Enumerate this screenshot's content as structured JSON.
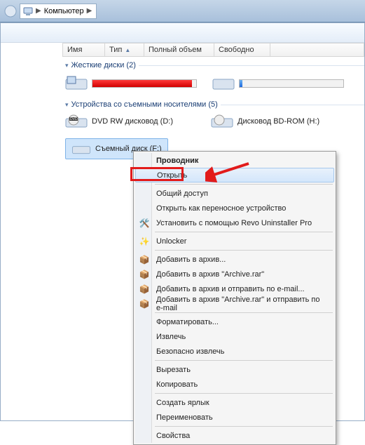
{
  "breadcrumb": {
    "location": "Компьютер"
  },
  "columns": {
    "name": "Имя",
    "type": "Тип",
    "total": "Полный объем",
    "free": "Свободно"
  },
  "groups": {
    "hdd": {
      "label": "Жесткие диски (2)"
    },
    "removable": {
      "label": "Устройства со съемными носителями (5)"
    }
  },
  "devices": {
    "dvd": "DVD RW дисковод (D:)",
    "bd": "Дисковод BD-ROM (H:)",
    "removable_selected": "Съемный диск (F:)"
  },
  "ctx": {
    "explorer": "Проводник",
    "open": "Открыть",
    "share": "Общий доступ",
    "portable": "Открыть как переносное устройство",
    "revo": "Установить с помощью Revo Uninstaller Pro",
    "unlocker": "Unlocker",
    "archive_add": "Добавить в архив...",
    "archive_named": "Добавить в архив \"Archive.rar\"",
    "archive_email": "Добавить в архив и отправить по e-mail...",
    "archive_named_email": "Добавить в архив \"Archive.rar\" и отправить по e-mail",
    "format": "Форматировать...",
    "eject": "Извлечь",
    "safe_eject": "Безопасно извлечь",
    "cut": "Вырезать",
    "copy": "Копировать",
    "shortcut": "Создать ярлык",
    "rename": "Переименовать",
    "properties": "Свойства"
  }
}
